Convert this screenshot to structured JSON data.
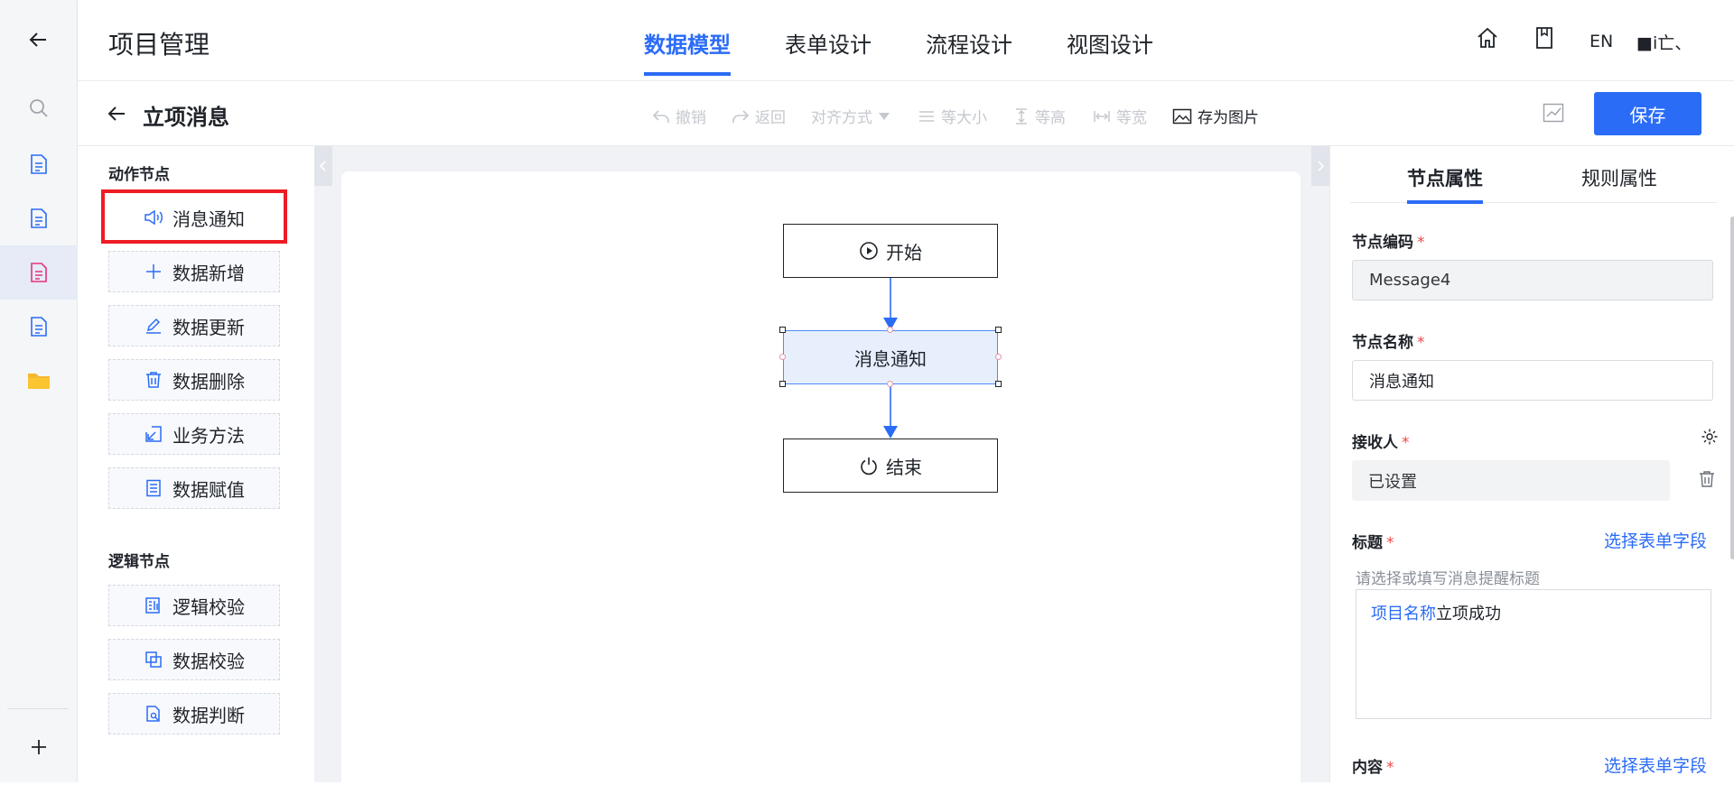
{
  "header": {
    "app_title": "项目管理",
    "tabs": [
      {
        "label": "数据模型",
        "active": true
      },
      {
        "label": "表单设计",
        "active": false
      },
      {
        "label": "流程设计",
        "active": false
      },
      {
        "label": "视图设计",
        "active": false
      }
    ],
    "lang": "EN",
    "user": "■ⅰ亡、"
  },
  "rail": {
    "icons": [
      "back-arrow-icon",
      "search-icon",
      "document-icon",
      "document-icon",
      "document-icon",
      "document-icon",
      "folder-icon",
      "plus-icon"
    ]
  },
  "toolbar": {
    "page_title": "立项消息",
    "undo": "撤销",
    "redo": "返回",
    "align": "对齐方式",
    "same_size": "等大小",
    "same_height": "等高",
    "same_width": "等宽",
    "save_image": "存为图片",
    "save_label": "保存"
  },
  "palette": {
    "action_section": "动作节点",
    "action_nodes": [
      {
        "label": "消息通知",
        "icon": "speaker-icon"
      },
      {
        "label": "数据新增",
        "icon": "plus-icon"
      },
      {
        "label": "数据更新",
        "icon": "pencil-icon"
      },
      {
        "label": "数据删除",
        "icon": "trash-icon"
      },
      {
        "label": "业务方法",
        "icon": "arrow-box-icon"
      },
      {
        "label": "数据赋值",
        "icon": "list-doc-icon"
      }
    ],
    "logic_section": "逻辑节点",
    "logic_nodes": [
      {
        "label": "逻辑校验",
        "icon": "checklist-icon"
      },
      {
        "label": "数据校验",
        "icon": "copy-icon"
      },
      {
        "label": "数据判断",
        "icon": "doc-search-icon"
      }
    ]
  },
  "flow": {
    "start": "开始",
    "message": "消息通知",
    "end": "结束"
  },
  "props": {
    "tab_node": "节点属性",
    "tab_rule": "规则属性",
    "code_label": "节点编码",
    "code_value": "Message4",
    "name_label": "节点名称",
    "name_value": "消息通知",
    "receiver_label": "接收人",
    "receiver_value": "已设置",
    "title_label": "标题",
    "select_field": "选择表单字段",
    "title_hint": "请选择或填写消息提醒标题",
    "title_tag": "项目名称",
    "title_text": "立项成功",
    "content_label": "内容",
    "required_mark": "*"
  },
  "colors": {
    "accent": "#2b6cf6",
    "highlight": "#ee1c25",
    "required": "#f04848"
  }
}
